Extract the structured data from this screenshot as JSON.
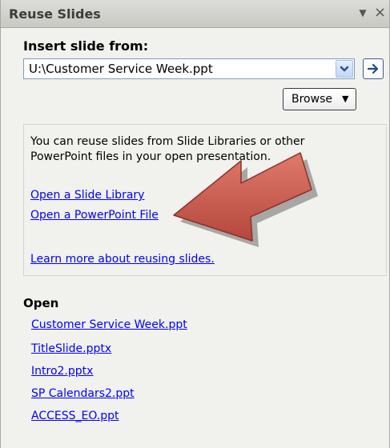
{
  "pane": {
    "title": "Reuse Slides",
    "dropdown_glyph": "▼",
    "close_glyph": "×"
  },
  "insert": {
    "label": "Insert slide from:",
    "source_value": "U:\\Customer Service Week.ppt",
    "browse_label": "Browse",
    "browse_arrow": "▼",
    "go_icon": "arrow-right-icon"
  },
  "info": {
    "text": "You can reuse slides from Slide Libraries or other PowerPoint files in your open presentation.",
    "link_slide_library": "Open a Slide Library",
    "link_powerpoint_file": "Open a PowerPoint File",
    "link_learn_more": "Learn more about reusing slides."
  },
  "open": {
    "heading": "Open",
    "files": [
      "Customer Service Week.ppt",
      "TitleSlide.pptx",
      "Intro2.pptx",
      "SP Calendars2.ppt",
      "ACCESS_EO.ppt"
    ]
  },
  "colors": {
    "link": "#0000ff",
    "callout_arrow": "#c8574a"
  }
}
